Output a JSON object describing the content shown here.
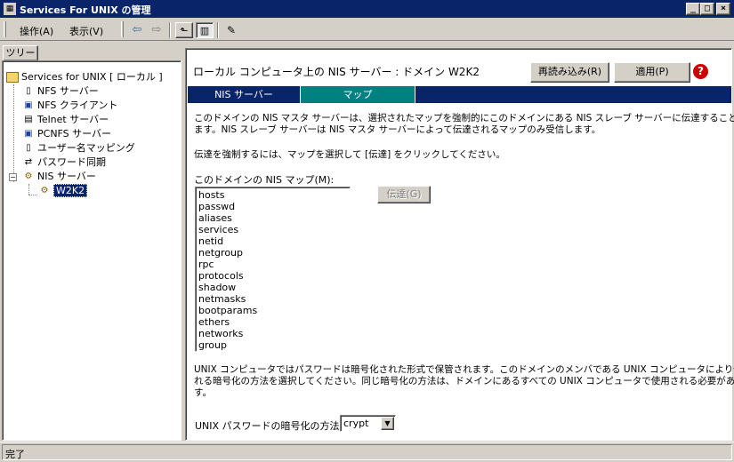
{
  "window": {
    "title": "Services For UNIX の管理",
    "min": "_",
    "max": "□",
    "close": "×"
  },
  "menu": {
    "action": "操作(A)",
    "view": "表示(V)"
  },
  "toolbar": {
    "icons": [
      "back-arrow-icon",
      "forward-arrow-icon",
      "up-folder-icon",
      "show-tree-icon",
      "help-icon"
    ]
  },
  "tree": {
    "tab_label": "ツリー",
    "root": "Services for UNIX [ ローカル ]",
    "items": [
      "NFS サーバー",
      "NFS クライアント",
      "Telnet サーバー",
      "PCNFS サーバー",
      "ユーザー名マッピング",
      "パスワード同期",
      "NIS サーバー"
    ],
    "child": "W2K2"
  },
  "main": {
    "header": "ローカル コンピュータ上の NIS サーバー : ドメイン W2K2",
    "reload_button": "再読み込み(R)",
    "apply_button": "適用(P)",
    "tabs": [
      "NIS サーバー",
      "マップ"
    ],
    "desc1_line1": "このドメインの NIS マスタ サーバーは、選択されたマップを強制的にこのドメインにある NIS スレーブ サーバーに伝達することができ",
    "desc1_line2": "ます。NIS スレーブ サーバーは NIS マスタ サーバーによって伝達されるマップのみ受信します。",
    "desc2": "伝達を強制するには、マップを選択して [伝達] をクリックしてください。",
    "maps_label": "このドメインの NIS マップ(M):",
    "maps": [
      "hosts",
      "passwd",
      "aliases",
      "services",
      "netid",
      "netgroup",
      "rpc",
      "protocols",
      "shadow",
      "netmasks",
      "bootparams",
      "ethers",
      "networks",
      "group"
    ],
    "propagate_button": "伝達(G)",
    "desc3_line1": "UNIX コンピュータではパスワードは暗号化された形式で保管されます。このドメインのメンバである UNIX コンピュータにより使用さ",
    "desc3_line2": "れる暗号化の方法を選択してください。同じ暗号化の方法は、ドメインにあるすべての UNIX コンピュータで使用される必要がありま",
    "desc3_line3": "す。",
    "encryption_label": "UNIX パスワードの暗号化の方法:",
    "encryption_value": "crypt"
  },
  "status": {
    "text": "完了"
  },
  "colors": {
    "title_bg": "#0a246a",
    "tab_active": "#008080",
    "help_red": "#cc0000"
  }
}
